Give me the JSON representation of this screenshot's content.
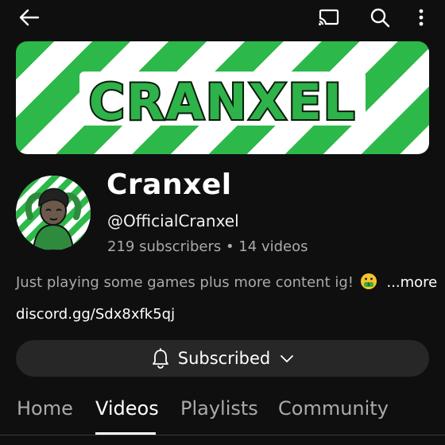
{
  "channel": {
    "banner_text": "CRANXEL",
    "name": "Cranxel",
    "handle": "@OfficialCranxel",
    "stats": "219 subscribers • 14 videos",
    "description": "Just playing some games plus more content ig!",
    "description_more": "...more",
    "link": "discord.gg/Sdx8xfk5qj"
  },
  "subscribe": {
    "label": "Subscribed"
  },
  "tabs": [
    {
      "label": "Home",
      "active": false
    },
    {
      "label": "Videos",
      "active": true
    },
    {
      "label": "Playlists",
      "active": false
    },
    {
      "label": "Community",
      "active": false
    }
  ],
  "icons": {
    "back": "arrow-left-icon",
    "cast": "cast-icon",
    "search": "search-icon",
    "more": "more-vert-icon",
    "bell": "bell-icon",
    "chevron": "chevron-down-icon",
    "emoji": "money-mouth-face-emoji"
  },
  "colors": {
    "accent": "#2db84a",
    "background": "#0f0f0f",
    "button": "#272727"
  }
}
